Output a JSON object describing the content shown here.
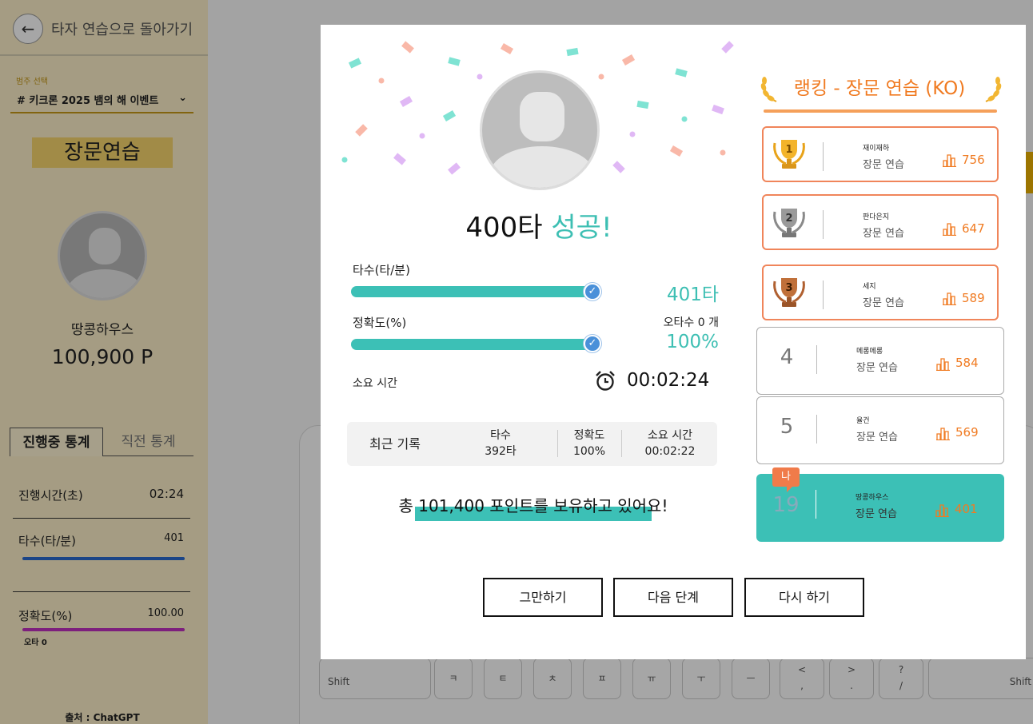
{
  "sidebar": {
    "back_label": "타자 연습으로 돌아가기",
    "selector_caption": "범주 선택",
    "selector_value": "# 키크론 2025 뱀의 해 이벤트",
    "mode_title": "장문연습",
    "user_name": "땅콩하우스",
    "user_points": "100,900 P",
    "stat_tabs": [
      "진행중 통계",
      "직전 통계"
    ],
    "stats": {
      "time_label": "진행시간(초)",
      "time_value": "02:24",
      "speed_label": "타수(타/분)",
      "speed_value": "401",
      "accuracy_label": "정확도(%)",
      "accuracy_value": "100.00",
      "typo_label": "오타 0"
    },
    "source": "출처 : ChatGPT"
  },
  "keyboard": {
    "keys_row1": [
      "Shift",
      "ㅋ",
      "ㅌ",
      "ㅊ",
      "ㅍ",
      "ㅠ",
      "ㅜ",
      "ㅡ",
      "<\n,",
      ">\n.",
      "?\n/",
      "Shift"
    ]
  },
  "result": {
    "title_main": "400타 ",
    "title_success": "성공!",
    "speed_label": "타수(타/분)",
    "speed_value": "401타",
    "speed_fill": 1.0,
    "accuracy_label": "정확도(%)",
    "accuracy_value": "100%",
    "accuracy_fill": 1.0,
    "typo_count": "오타수 0 개",
    "time_label": "소요 시간",
    "time_value": "00:02:24",
    "recent": {
      "title": "최근 기록",
      "cols": [
        {
          "label": "타수",
          "value": "392타"
        },
        {
          "label": "정확도",
          "value": "100%"
        },
        {
          "label": "소요 시간",
          "value": "00:02:22"
        }
      ]
    },
    "points_message": "총 101,400 포인트를 보유하고 있어요!"
  },
  "ranking": {
    "title": "랭킹 - 장문 연습 (KO)",
    "entries": [
      {
        "rank": "1",
        "name": "재이재하",
        "mode": "장문 연습",
        "score": "756",
        "medal": "gold"
      },
      {
        "rank": "2",
        "name": "판다은지",
        "mode": "장문 연습",
        "score": "647",
        "medal": "silver"
      },
      {
        "rank": "3",
        "name": "세지",
        "mode": "장문 연습",
        "score": "589",
        "medal": "bronze"
      },
      {
        "rank": "4",
        "name": "메롱메롱",
        "mode": "장문 연습",
        "score": "584"
      },
      {
        "rank": "5",
        "name": "율건",
        "mode": "장문 연습",
        "score": "569"
      },
      {
        "rank": "19",
        "name": "땅콩하우스",
        "mode": "장문 연습",
        "score": "401",
        "me_tag": "나"
      }
    ]
  },
  "buttons": {
    "quit": "그만하기",
    "next": "다음 단계",
    "retry": "다시 하기"
  },
  "colors": {
    "accent_teal": "#3cc0b6",
    "accent_orange": "#f07b22",
    "sidebar_bg": "#fdf0ca"
  }
}
